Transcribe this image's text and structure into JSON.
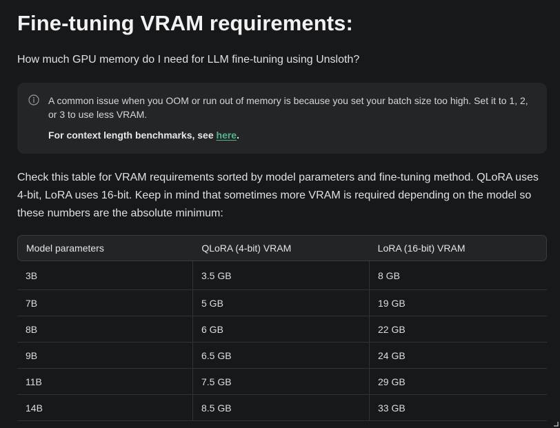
{
  "title": "Fine-tuning VRAM requirements:",
  "subtitle": "How much GPU memory do I need for LLM fine-tuning using Unsloth?",
  "hint": {
    "icon": "info-icon",
    "text": "A common issue when you OOM or run out of memory is because you set your batch size too high. Set it to 1, 2, or 3 to use less VRAM.",
    "bold_prefix": "For context length benchmarks, see ",
    "link_text": "here",
    "bold_suffix": "."
  },
  "paragraph": "Check this table for VRAM requirements sorted by model parameters and fine-tuning method. QLoRA uses 4-bit, LoRA uses 16-bit. Keep in mind that sometimes more VRAM is required depending on the model so these numbers are the absolute minimum:",
  "table": {
    "headers": [
      "Model parameters",
      "QLoRA (4-bit) VRAM",
      "LoRA (16-bit) VRAM"
    ],
    "rows": [
      [
        "3B",
        "3.5 GB",
        "8 GB"
      ],
      [
        "7B",
        "5 GB",
        "19 GB"
      ],
      [
        "8B",
        "6 GB",
        "22 GB"
      ],
      [
        "9B",
        "6.5 GB",
        "24 GB"
      ],
      [
        "11B",
        "7.5 GB",
        "29 GB"
      ],
      [
        "14B",
        "8.5 GB",
        "33 GB"
      ]
    ]
  },
  "colors": {
    "background": "#17181a",
    "hint_background": "#242527",
    "link": "#55b48e"
  }
}
